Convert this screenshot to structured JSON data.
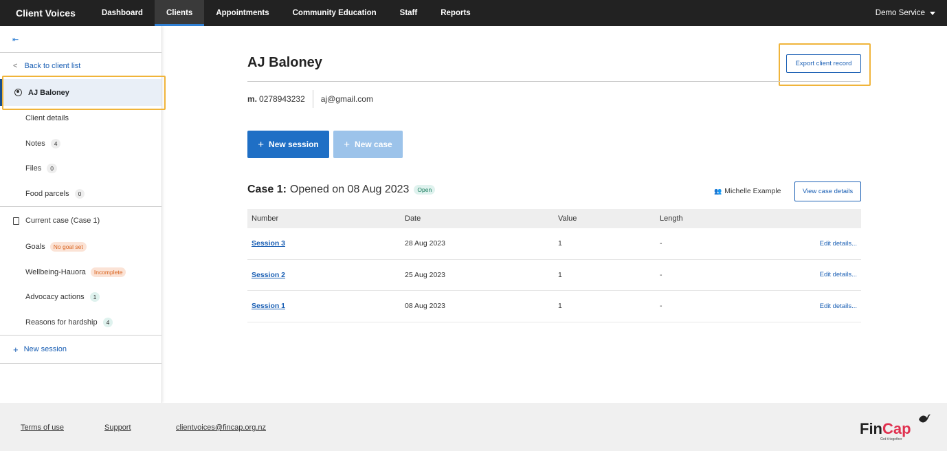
{
  "nav": {
    "brand": "Client Voices",
    "items": [
      "Dashboard",
      "Clients",
      "Appointments",
      "Community Education",
      "Staff",
      "Reports"
    ],
    "active": "Clients",
    "service": "Demo Service"
  },
  "sidebar": {
    "collapse_icon": "collapse-left-icon",
    "back_label": "Back to client list",
    "client_name": "AJ Baloney",
    "client_items": [
      {
        "label": "Client details"
      },
      {
        "label": "Notes",
        "count": "4"
      },
      {
        "label": "Files",
        "count": "0"
      },
      {
        "label": "Food parcels",
        "count": "0"
      }
    ],
    "case_heading": "Current case (Case 1)",
    "case_items": [
      {
        "label": "Goals",
        "tag": "No goal set"
      },
      {
        "label": "Wellbeing-Hauora",
        "tag": "Incomplete"
      },
      {
        "label": "Advocacy actions",
        "count": "1"
      },
      {
        "label": "Reasons for hardship",
        "count": "4"
      }
    ],
    "new_session_label": "New session"
  },
  "client": {
    "name": "AJ Baloney",
    "phone_prefix": "m.",
    "phone": "0278943232",
    "email": "aj@gmail.com",
    "export_label": "Export client record"
  },
  "actions": {
    "new_session": "New session",
    "new_case": "New case"
  },
  "case": {
    "title_bold": "Case 1:",
    "title_rest": "Opened on 08 Aug 2023",
    "status": "Open",
    "assignee": "Michelle Example",
    "view_label": "View case details",
    "columns": [
      "Number",
      "Date",
      "Value",
      "Length"
    ],
    "rows": [
      {
        "number": "Session 3",
        "date": "28 Aug 2023",
        "value": "1",
        "length": "-",
        "edit": "Edit details..."
      },
      {
        "number": "Session 2",
        "date": "25 Aug 2023",
        "value": "1",
        "length": "-",
        "edit": "Edit details..."
      },
      {
        "number": "Session 1",
        "date": "08 Aug 2023",
        "value": "1",
        "length": "-",
        "edit": "Edit details..."
      }
    ]
  },
  "footer": {
    "terms": "Terms of use",
    "support": "Support",
    "email": "clientvoices@fincap.org.nz",
    "logo_fin": "Fin",
    "logo_cap": "Cap",
    "logo_tagline": "Got it together"
  },
  "colors": {
    "primary": "#1f6fc5",
    "highlight": "#f0b43a",
    "topbar": "#222222"
  }
}
